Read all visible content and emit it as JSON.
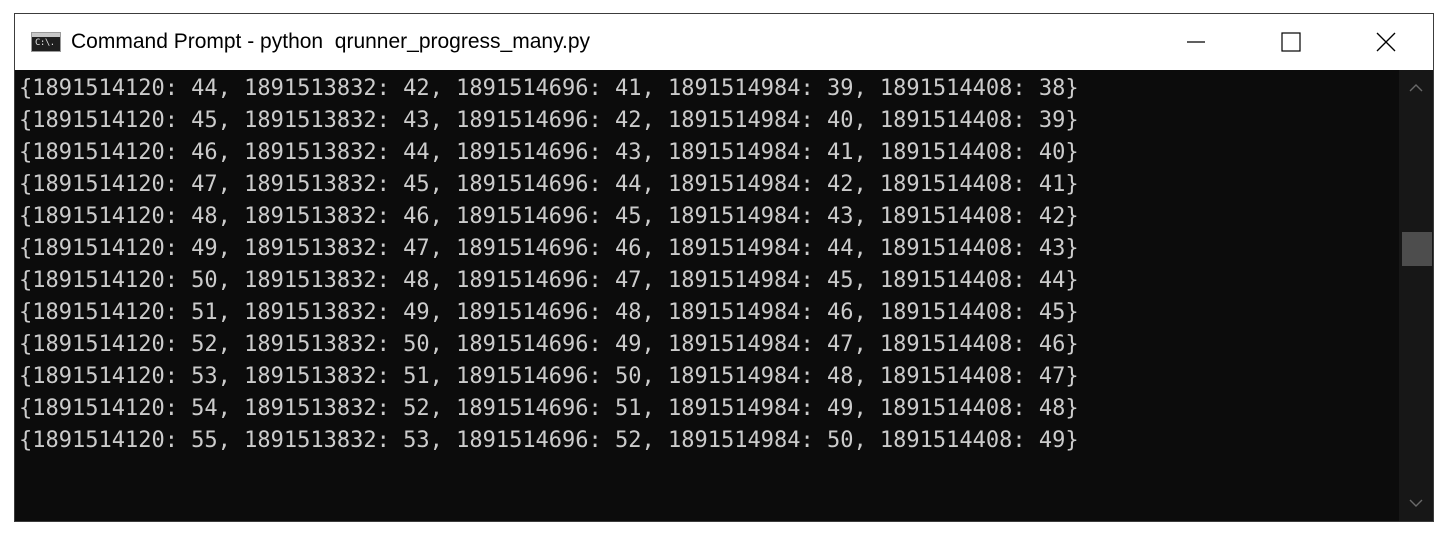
{
  "window": {
    "title": "Command Prompt - python  qrunner_progress_many.py",
    "icon": "cmd-icon",
    "icon_text": "C:\\."
  },
  "caption_buttons": {
    "minimize": "minimize-icon",
    "maximize": "maximize-icon",
    "close": "close-icon"
  },
  "console": {
    "lines": [
      "{1891514120: 44, 1891513832: 42, 1891514696: 41, 1891514984: 39, 1891514408: 38}",
      "{1891514120: 45, 1891513832: 43, 1891514696: 42, 1891514984: 40, 1891514408: 39}",
      "{1891514120: 46, 1891513832: 44, 1891514696: 43, 1891514984: 41, 1891514408: 40}",
      "{1891514120: 47, 1891513832: 45, 1891514696: 44, 1891514984: 42, 1891514408: 41}",
      "{1891514120: 48, 1891513832: 46, 1891514696: 45, 1891514984: 43, 1891514408: 42}",
      "{1891514120: 49, 1891513832: 47, 1891514696: 46, 1891514984: 44, 1891514408: 43}",
      "{1891514120: 50, 1891513832: 48, 1891514696: 47, 1891514984: 45, 1891514408: 44}",
      "{1891514120: 51, 1891513832: 49, 1891514696: 48, 1891514984: 46, 1891514408: 45}",
      "{1891514120: 52, 1891513832: 50, 1891514696: 49, 1891514984: 47, 1891514408: 46}",
      "{1891514120: 53, 1891513832: 51, 1891514696: 50, 1891514984: 48, 1891514408: 47}",
      "{1891514120: 54, 1891513832: 52, 1891514696: 51, 1891514984: 49, 1891514408: 48}",
      "{1891514120: 55, 1891513832: 53, 1891514696: 52, 1891514984: 50, 1891514408: 49}"
    ],
    "text_color": "#cccccc",
    "background": "#0c0c0c"
  },
  "scrollbar": {
    "up": "chevron-up-icon",
    "down": "chevron-down-icon",
    "thumb_position": 0.4
  }
}
